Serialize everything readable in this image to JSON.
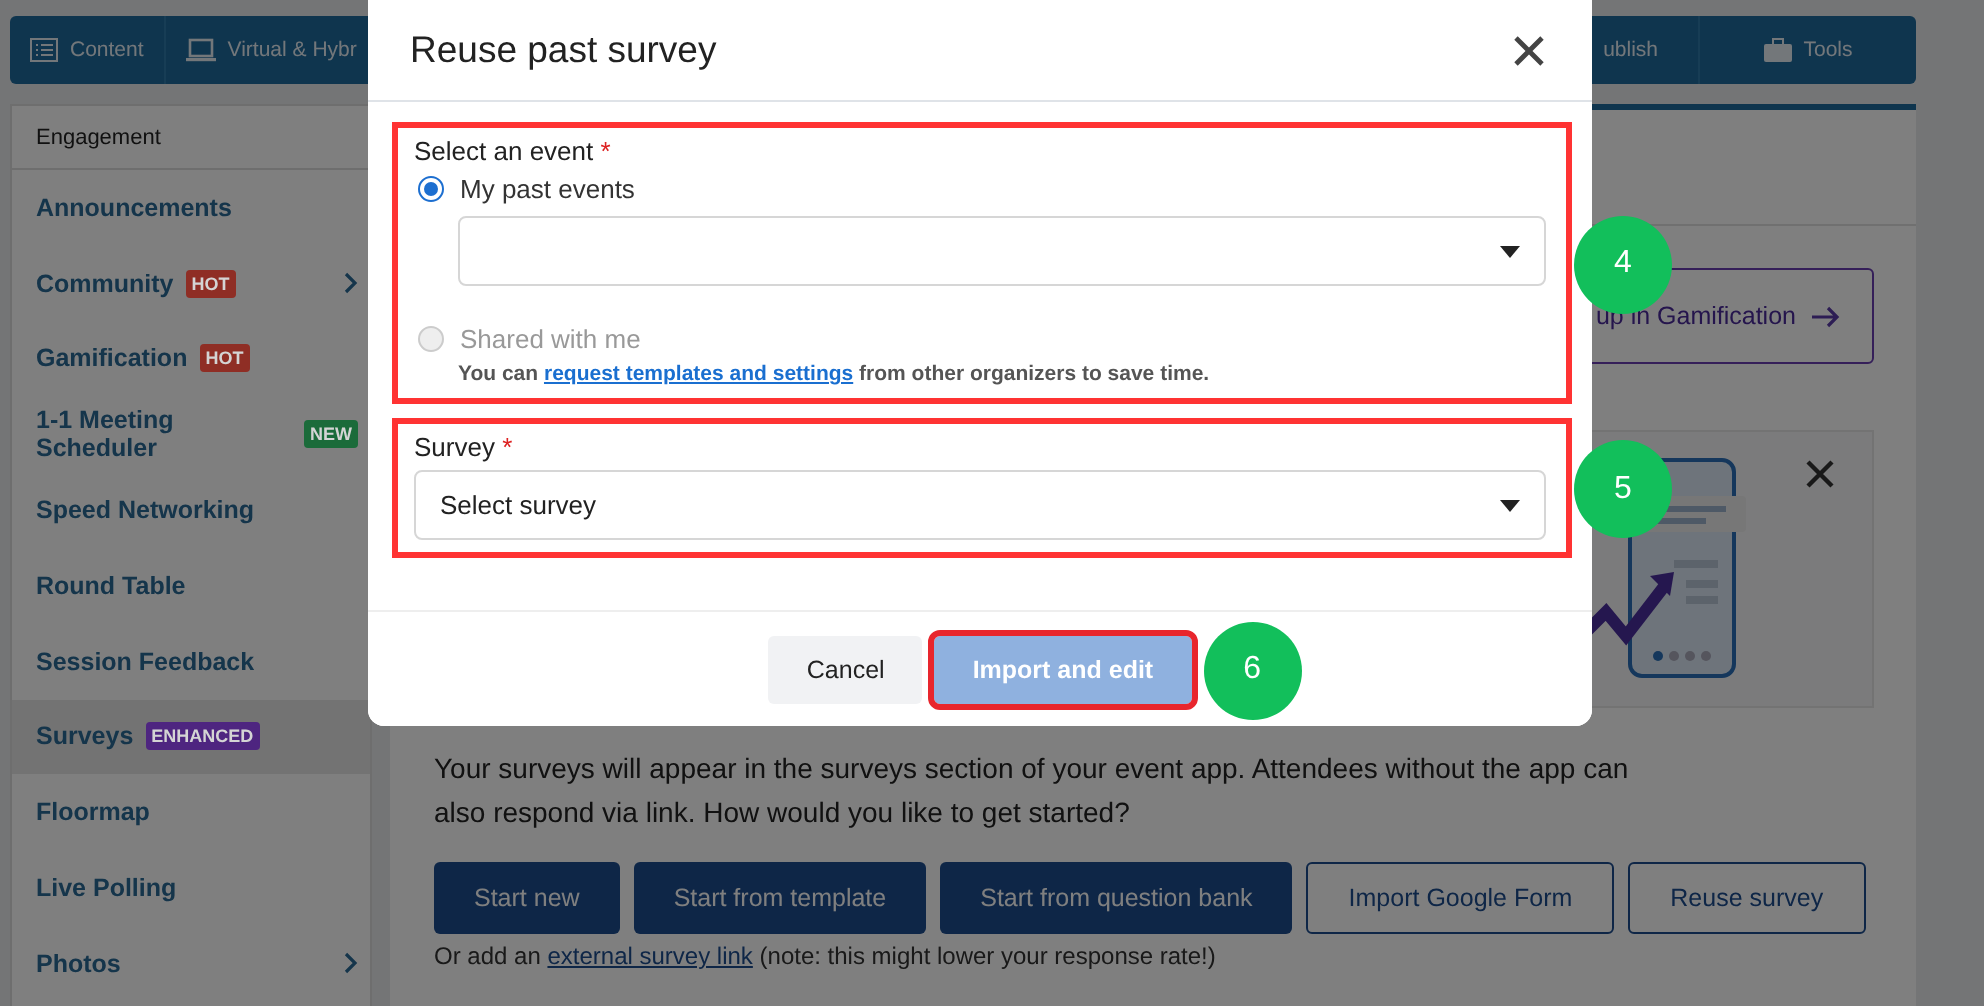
{
  "top_nav": {
    "items": [
      {
        "label": "Content"
      },
      {
        "label": "Virtual & Hybr"
      },
      {
        "label": "ublish"
      },
      {
        "label": "Tools"
      }
    ]
  },
  "sidebar": {
    "header": "Engagement",
    "items": [
      {
        "label": "Announcements",
        "selected": false,
        "submenu": false
      },
      {
        "label": "Community",
        "badge": {
          "text": "HOT",
          "color": "#8f2e25"
        },
        "selected": false,
        "submenu": true
      },
      {
        "label": "Gamification",
        "badge": {
          "text": "HOT",
          "color": "#8f2e25"
        },
        "selected": false,
        "submenu": false
      },
      {
        "label": "1-1 Meeting Scheduler",
        "badge": {
          "text": "NEW",
          "color": "#1b6b3a"
        },
        "selected": false,
        "submenu": false
      },
      {
        "label": "Speed Networking",
        "selected": false,
        "submenu": false
      },
      {
        "label": "Round Table",
        "selected": false,
        "submenu": false
      },
      {
        "label": "Session Feedback",
        "selected": false,
        "submenu": false
      },
      {
        "label": "Surveys",
        "badge": {
          "text": "ENHANCED",
          "color": "#4e2580"
        },
        "selected": true,
        "submenu": false
      },
      {
        "label": "Floormap",
        "selected": false,
        "submenu": false
      },
      {
        "label": "Live Polling",
        "selected": false,
        "submenu": false
      },
      {
        "label": "Photos",
        "selected": false,
        "submenu": true
      }
    ]
  },
  "main": {
    "gamification_link": "up in Gamification",
    "paragraph": "Your surveys will appear in the surveys section of your event app. Attendees without the app can also respond via link. How would you like to get started?",
    "buttons": [
      {
        "label": "Start new",
        "kind": "primary"
      },
      {
        "label": "Start from template",
        "kind": "primary"
      },
      {
        "label": "Start from question bank",
        "kind": "primary"
      },
      {
        "label": "Import Google Form",
        "kind": "outline"
      },
      {
        "label": "Reuse survey",
        "kind": "outline"
      }
    ],
    "footnote": {
      "prefix": "Or add an",
      "link": "external survey link",
      "suffix": "(note: this might lower your response rate!)"
    }
  },
  "modal": {
    "title": "Reuse past survey",
    "event_section": {
      "highlighted": true,
      "step": "4",
      "label": "Select an event",
      "required_mark": "*",
      "options": [
        {
          "label": "My past events",
          "selected": true,
          "disabled": false
        },
        {
          "label": "Shared with me",
          "selected": false,
          "disabled": true
        }
      ],
      "hint": {
        "prefix": "You can",
        "link": "request templates and settings",
        "suffix": "from other organizers to save time."
      }
    },
    "survey_section": {
      "highlighted": true,
      "step": "5",
      "label": "Survey",
      "required_mark": "*",
      "placeholder": "Select survey"
    },
    "buttons": [
      {
        "label": "Cancel",
        "kind": "secondary",
        "highlighted": false
      },
      {
        "label": "Import and edit",
        "kind": "primary",
        "highlighted": true,
        "step": "6"
      }
    ]
  }
}
